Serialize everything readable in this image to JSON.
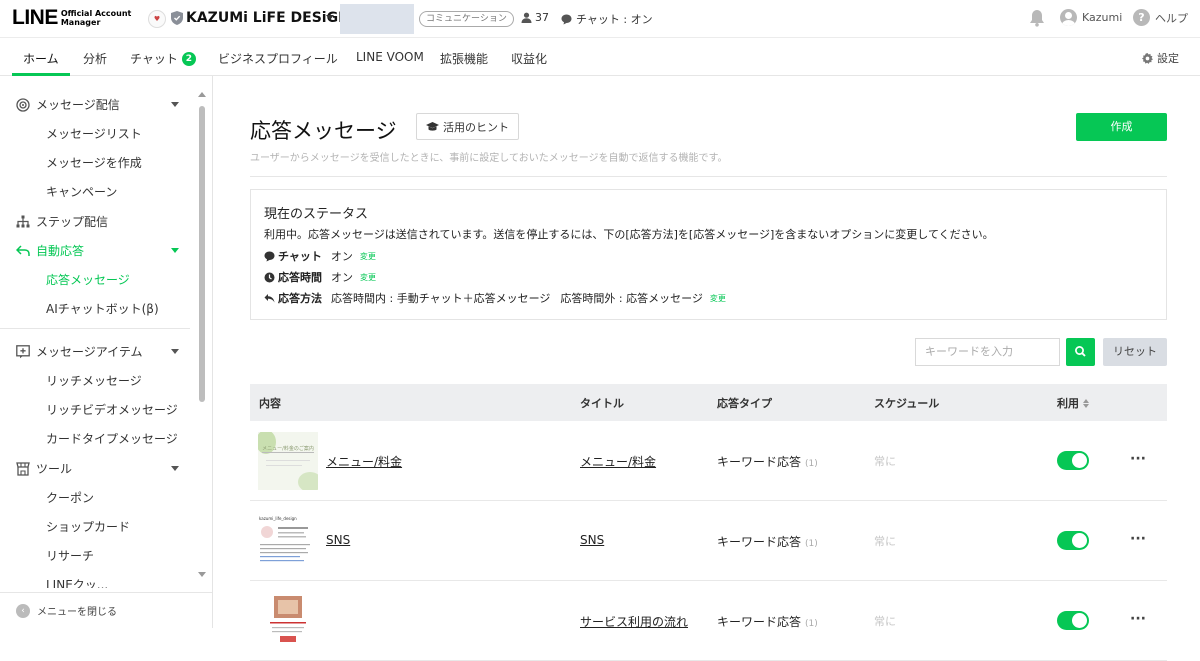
{
  "header": {
    "logo_main": "LINE",
    "logo_sub_1": "Official Account",
    "logo_sub_2": "Manager",
    "account_name": "KAZUMi LiFE DESiGN",
    "account_type_badge": "コミュニケーション",
    "followers": "37",
    "chat_status": "チャット : オン",
    "user_name": "Kazumi",
    "help": "ヘルプ"
  },
  "nav": {
    "tabs": [
      {
        "label": "ホーム",
        "active": true
      },
      {
        "label": "分析"
      },
      {
        "label": "チャット",
        "badge": "2"
      },
      {
        "label": "ビジネスプロフィール"
      },
      {
        "label": "LINE VOOM"
      },
      {
        "label": "拡張機能"
      },
      {
        "label": "収益化"
      }
    ],
    "settings": "設定"
  },
  "sidebar": {
    "groups": [
      {
        "label": "メッセージ配信",
        "icon": "broadcast-icon"
      },
      {
        "label": "ステップ配信",
        "icon": "step-icon"
      },
      {
        "label": "自動応答",
        "icon": "auto-reply-icon",
        "active": true
      },
      {
        "label": "メッセージアイテム",
        "icon": "message-item-icon"
      },
      {
        "label": "ツール",
        "icon": "tool-icon"
      }
    ],
    "items": [
      "メッセージリスト",
      "メッセージを作成",
      "キャンペーン",
      "応答メッセージ",
      "AIチャットボット(β)",
      "リッチメッセージ",
      "リッチビデオメッセージ",
      "カードタイプメッセージ",
      "クーポン",
      "ショップカード",
      "リサーチ",
      "LINEクッ..."
    ],
    "close_menu": "メニューを閉じる"
  },
  "main": {
    "title": "応答メッセージ",
    "hint_button": "活用のヒント",
    "create_button": "作成",
    "description": "ユーザーからメッセージを受信したときに、事前に設定しておいたメッセージを自動で返信する機能です。",
    "status": {
      "title": "現在のステータス",
      "message": "利用中。応答メッセージは送信されています。送信を停止するには、下の[応答方法]を[応答メッセージ]を含まないオプションに変更してください。",
      "rows": [
        {
          "icon": "chat-bubble-icon",
          "label": "チャット",
          "value": "オン",
          "change": "変更"
        },
        {
          "icon": "clock-icon",
          "label": "応答時間",
          "value": "オン",
          "change": "変更"
        },
        {
          "icon": "reply-arrow-icon",
          "label": "応答方法",
          "value": "応答時間内 : 手動チャット＋応答メッセージ",
          "value2": "応答時間外 : 応答メッセージ",
          "change": "変更"
        }
      ]
    },
    "search": {
      "placeholder": "キーワードを入力",
      "reset": "リセット"
    },
    "table": {
      "headers": [
        "内容",
        "タイトル",
        "応答タイプ",
        "スケジュール",
        "利用"
      ],
      "rows": [
        {
          "content": "メニュー/料金",
          "title": "メニュー/料金",
          "type": "キーワード応答",
          "count": "(1)",
          "schedule": "常に",
          "enabled": true
        },
        {
          "content": "SNS",
          "title": "SNS",
          "type": "キーワード応答",
          "count": "(1)",
          "schedule": "常に",
          "enabled": true
        },
        {
          "content": "",
          "title": "サービス利用の流れ",
          "type": "キーワード応答",
          "count": "(1)",
          "schedule": "常に",
          "enabled": true
        }
      ],
      "thumbs": [
        {
          "caption": "メニュー/料金のご案内"
        },
        {
          "caption": "kazumi_life_design"
        },
        {
          "caption": ""
        }
      ]
    }
  },
  "colors": {
    "accent": "#06c755",
    "table_head_bg": "#edeef0",
    "reset_bg": "#d9dde3"
  }
}
